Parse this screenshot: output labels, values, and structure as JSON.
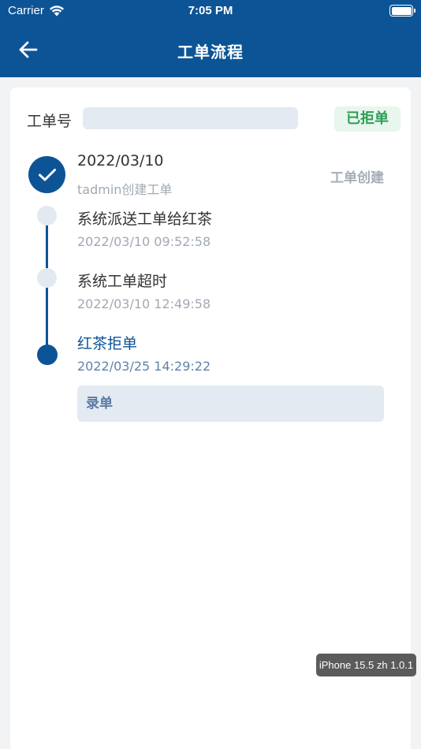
{
  "status_bar": {
    "carrier": "Carrier",
    "time": "7:05 PM"
  },
  "nav": {
    "title": "工单流程",
    "back_icon": "arrow-left-icon"
  },
  "order": {
    "label": "工单号",
    "number": "",
    "status": "已拒单",
    "status_color": "#2e9d57"
  },
  "timeline": [
    {
      "title": "2022/03/10",
      "subtitle": "tadmin创建工单",
      "tag": "工单创建",
      "state": "done"
    },
    {
      "title": "系统派送工单给红茶",
      "subtitle": "2022/03/10  09:52:58",
      "state": "pending"
    },
    {
      "title": "系统工单超时",
      "subtitle": "2022/03/10  12:49:58",
      "state": "pending"
    },
    {
      "title": "红茶拒单",
      "subtitle": "2022/03/25  14:29:22",
      "state": "current",
      "remark": "录单"
    }
  ],
  "version": "iPhone 15.5 zh 1.0.1",
  "colors": {
    "primary": "#0c5496",
    "badge_bg": "#e8f6ee",
    "field_bg": "#e3eaf2"
  }
}
